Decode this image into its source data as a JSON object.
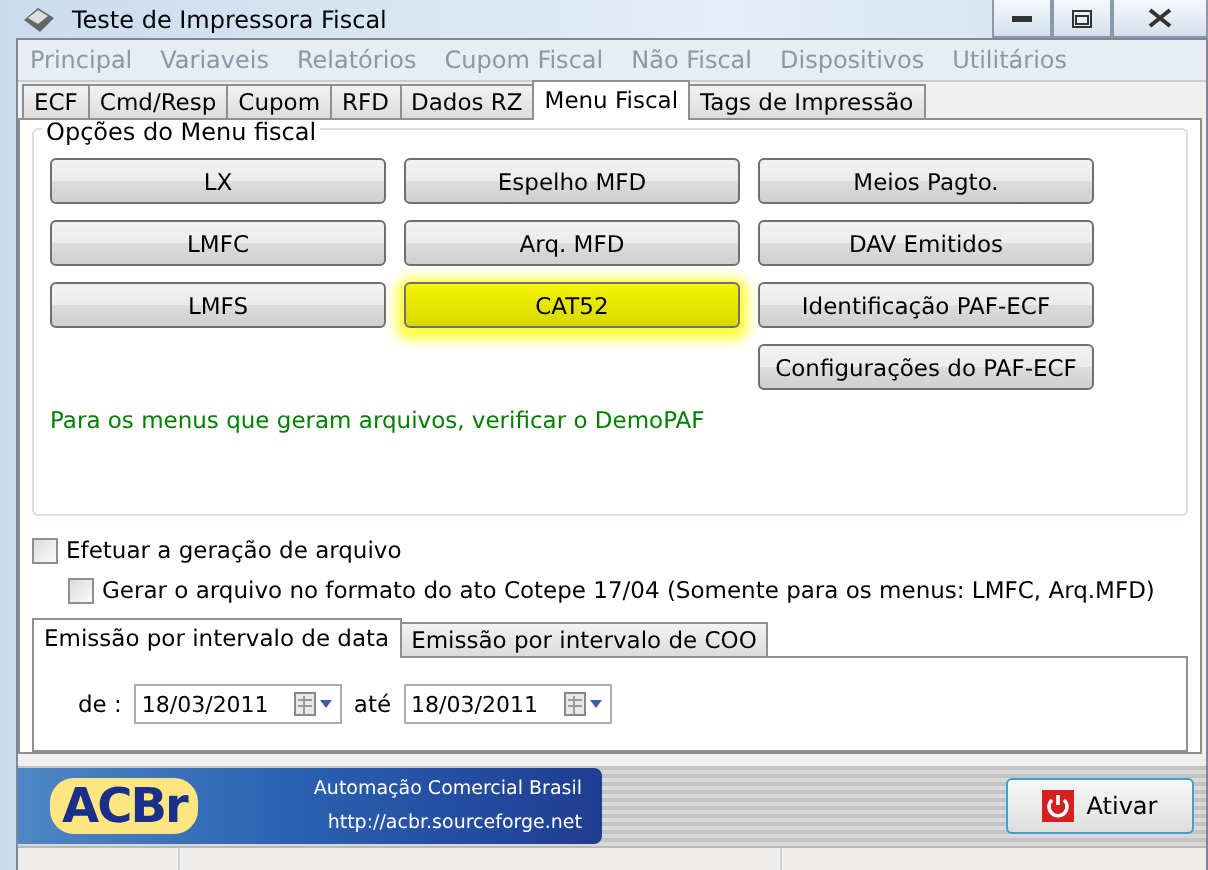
{
  "window": {
    "title": "Teste de Impressora Fiscal"
  },
  "menu": [
    {
      "label": "Principal",
      "disabled": true
    },
    {
      "label": "Variaveis",
      "disabled": true
    },
    {
      "label": "Relatórios",
      "disabled": true
    },
    {
      "label": "Cupom Fiscal",
      "disabled": true
    },
    {
      "label": "Não Fiscal",
      "disabled": true
    },
    {
      "label": "Dispositivos",
      "disabled": true
    },
    {
      "label": "Utilitários",
      "disabled": true
    }
  ],
  "tabs": [
    {
      "label": "ECF",
      "selected": false
    },
    {
      "label": "Cmd/Resp",
      "selected": false
    },
    {
      "label": "Cupom",
      "selected": false
    },
    {
      "label": "RFD",
      "selected": false
    },
    {
      "label": "Dados RZ",
      "selected": false
    },
    {
      "label": "Menu Fiscal",
      "selected": true
    },
    {
      "label": "Tags de Impressão",
      "selected": false
    }
  ],
  "group": {
    "title": "Opções do Menu fiscal",
    "columns": [
      [
        {
          "label": "LX",
          "highlighted": false
        },
        {
          "label": "LMFC",
          "highlighted": false
        },
        {
          "label": "LMFS",
          "highlighted": false
        }
      ],
      [
        {
          "label": "Espelho MFD",
          "highlighted": false
        },
        {
          "label": "Arq. MFD",
          "highlighted": false
        },
        {
          "label": "CAT52",
          "highlighted": true
        }
      ],
      [
        {
          "label": "Meios Pagto.",
          "highlighted": false
        },
        {
          "label": "DAV Emitidos",
          "highlighted": false
        },
        {
          "label": "Identificação PAF-ECF",
          "highlighted": false
        },
        {
          "label": "Configurações do PAF-ECF",
          "highlighted": false
        }
      ]
    ],
    "note": "Para os menus que geram arquivos, verificar o DemoPAF"
  },
  "checkboxes": [
    {
      "label": "Efetuar a geração de arquivo",
      "checked": false
    },
    {
      "label": "Gerar o arquivo no formato do ato Cotepe 17/04 (Somente para os menus: LMFC, Arq.MFD)",
      "checked": false
    }
  ],
  "subtabs": [
    {
      "label": "Emissão por intervalo de data",
      "selected": true
    },
    {
      "label": "Emissão por intervalo de COO",
      "selected": false
    }
  ],
  "dates": [
    {
      "label": "de :",
      "value": "18/03/2011"
    },
    {
      "label": "até",
      "value": "18/03/2011"
    }
  ],
  "banner": {
    "logo": "ACBr",
    "tagline": "Automação Comercial Brasil",
    "url": "http://acbr.sourceforge.net"
  },
  "action_button": {
    "label": "Ativar"
  }
}
